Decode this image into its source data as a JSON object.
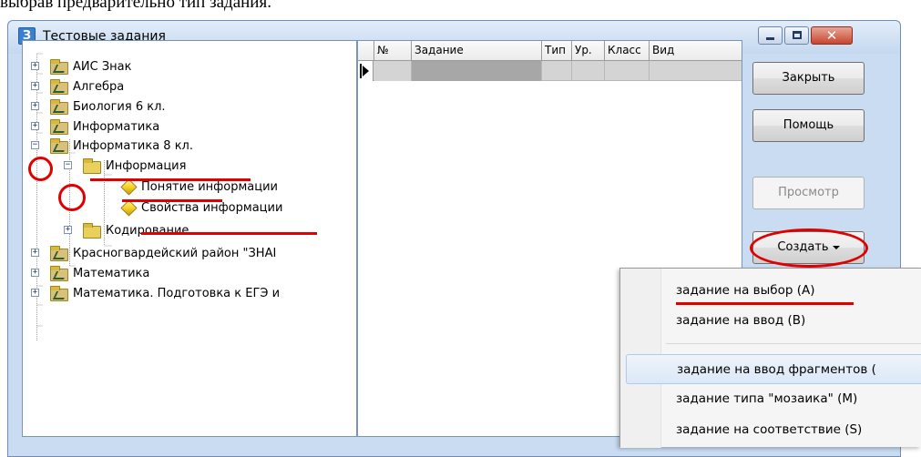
{
  "document": {
    "caption": "выбрав предварительно тип задания."
  },
  "window": {
    "title": "Тестовые задания",
    "icon": "app-icon"
  },
  "window_controls": {
    "minimize": "minimize-icon",
    "maximize": "maximize-icon",
    "close": "close-icon"
  },
  "tree": {
    "items": [
      {
        "label": "АИС Знак",
        "icon": "folder-icon",
        "expander": "+"
      },
      {
        "label": "Алгебра",
        "icon": "folder-icon",
        "expander": "+"
      },
      {
        "label": "Биология 6 кл.",
        "icon": "folder-icon",
        "expander": "+"
      },
      {
        "label": "Информатика",
        "icon": "folder-icon",
        "expander": "+"
      },
      {
        "label": "Информатика 8 кл.",
        "icon": "folder-icon",
        "expander": "−"
      },
      {
        "label": "Информация",
        "icon": "folder-open-icon",
        "expander": "−"
      },
      {
        "label": "Понятие информации",
        "icon": "cube-icon"
      },
      {
        "label": "Свойства информации",
        "icon": "cube-icon"
      },
      {
        "label": "Кодирование",
        "icon": "folder-open-icon",
        "expander": "+"
      },
      {
        "label": "Красногвардейский район \"ЗНАІ",
        "icon": "folder-icon",
        "expander": "+"
      },
      {
        "label": "Математика",
        "icon": "folder-icon",
        "expander": "+"
      },
      {
        "label": "Математика. Подготовка к ЕГЭ и",
        "icon": "folder-icon",
        "expander": "+"
      }
    ]
  },
  "grid": {
    "columns": [
      "№",
      "Задание",
      "Тип",
      "Ур.",
      "Класс",
      "Вид"
    ]
  },
  "buttons": {
    "close": "Закрыть",
    "help": "Помощь",
    "preview": "Просмотр",
    "create": "Создать"
  },
  "create_menu": {
    "items": [
      "задание на выбор (A)",
      "задание на ввод (B)",
      "задание на ввод фрагментов (",
      "задание типа \"мозаика\" (M)",
      "задание на соответствие (S)"
    ]
  },
  "annotation_color": "#e00000"
}
